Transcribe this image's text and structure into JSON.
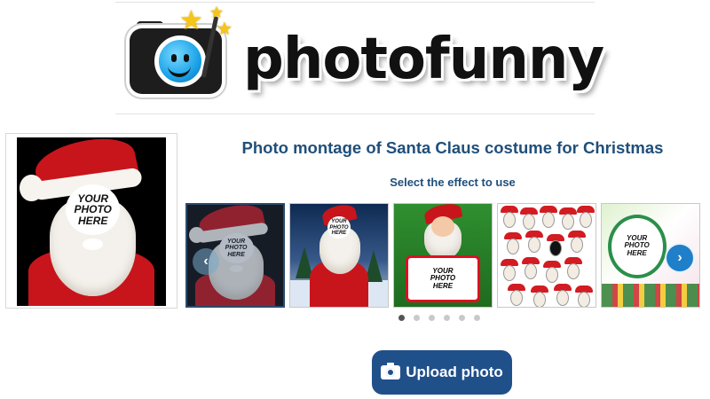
{
  "logo": {
    "text": "photofunny"
  },
  "preview": {
    "placeholder": [
      "YOUR",
      "PHOTO",
      "HERE"
    ]
  },
  "main": {
    "title": "Photo montage of Santa Claus costume for Christmas",
    "subtitle": "Select the effect to use"
  },
  "carousel": {
    "placeholder": [
      "YOUR",
      "PHOTO",
      "HERE"
    ],
    "dots_count": 6,
    "active_dot": 1,
    "prev_icon": "chevron-left-icon",
    "next_icon": "chevron-right-icon"
  },
  "upload": {
    "label": "Upload photo",
    "icon": "camera-icon"
  },
  "colors": {
    "title": "#1f4f7a",
    "button": "#20508a",
    "arrow": "#1f7fc8"
  }
}
